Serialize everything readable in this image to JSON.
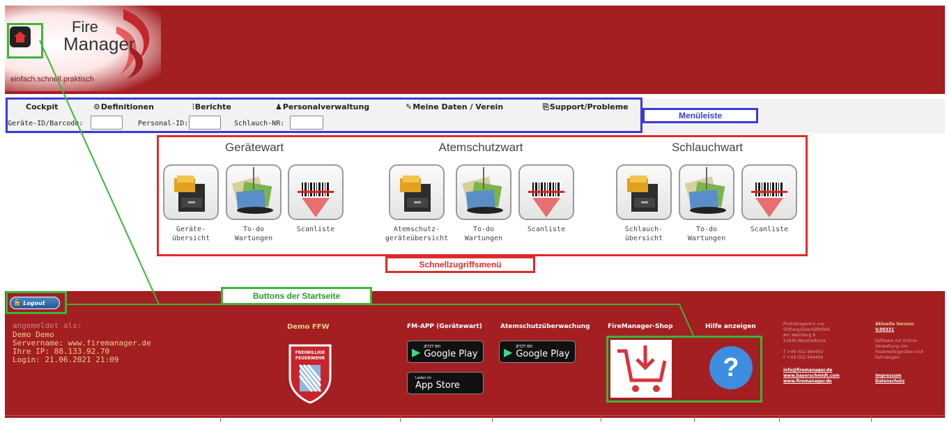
{
  "logo": {
    "line1": "Fire",
    "line2": "Manager",
    "slogan": "einfach.schnell.praktisch"
  },
  "menu": {
    "items": [
      {
        "label": "Cockpit",
        "icon": ""
      },
      {
        "label": "Definitionen",
        "icon": "gear-icon"
      },
      {
        "label": "Berichte",
        "icon": "sliders-icon"
      },
      {
        "label": "Personalverwaltung",
        "icon": "person-icon"
      },
      {
        "label": "Meine Daten / Verein",
        "icon": "wrench-icon"
      },
      {
        "label": "Support/Probleme",
        "icon": "support-icon"
      }
    ],
    "fields": [
      {
        "label": "Geräte-ID/Barcode:",
        "value": ""
      },
      {
        "label": "Personal-ID:",
        "value": ""
      },
      {
        "label": "Schlauch-NR:",
        "value": ""
      }
    ]
  },
  "callouts": {
    "menu": "Menüleiste",
    "quick": "Schnellzugriffsmenü",
    "buttons": "Buttons der Startseite"
  },
  "groups": [
    {
      "title": "Gerätewart",
      "tiles": [
        {
          "line1": "Geräte-",
          "line2": "übersicht",
          "icon": "file-cabinet-icon"
        },
        {
          "line1": "To-do",
          "line2": "Wartungen",
          "icon": "documents-icon"
        },
        {
          "line1": "Scanliste",
          "line2": "",
          "icon": "barcode-icon"
        }
      ]
    },
    {
      "title": "Atemschutzwart",
      "tiles": [
        {
          "line1": "Atemschutz-",
          "line2": "geräteübersicht",
          "icon": "file-cabinet-icon"
        },
        {
          "line1": "To-do",
          "line2": "Wartungen",
          "icon": "documents-icon"
        },
        {
          "line1": "Scanliste",
          "line2": "",
          "icon": "barcode-icon"
        }
      ]
    },
    {
      "title": "Schlauchwart",
      "tiles": [
        {
          "line1": "Schlauch-",
          "line2": "übersicht",
          "icon": "file-cabinet-icon"
        },
        {
          "line1": "To-do",
          "line2": "Wartungen",
          "icon": "documents-icon"
        },
        {
          "line1": "Scanliste",
          "line2": "",
          "icon": "barcode-icon"
        }
      ]
    }
  ],
  "footer": {
    "logout_label": "Logout",
    "login_info": [
      "angemeldet als:",
      "Demo Demo",
      "Servername: www.firemanager.de",
      "Ihre IP: 88.133.92.70",
      "Login: 21.06.2021 21:09"
    ],
    "org_name": "Demo FFW",
    "badge": {
      "line1": "FREIWILLIGE",
      "line2": "FEUERWEHR"
    },
    "app_heading": "FM-APP (Gerätewart)",
    "breath_heading": "Atemschutzüberwachung",
    "shop_heading": "FireManager-Shop",
    "help_heading": "Hilfe anzeigen",
    "store": {
      "gp_small": "JETZT BEI",
      "gp_big": "Google Play",
      "as_small": "Laden im",
      "as_big": "App Store"
    },
    "company": [
      "Produktagentur xxx",
      "Stiftung/Geschäftsfeld",
      "Am Weinberg 8",
      "51645 Neustadt/xxx",
      "",
      "T +49 (0)2 944403",
      "F +49 (0)2 944404"
    ],
    "links": [
      "info@firemanager.de",
      "www.bayerschmidt.com",
      "www.firemanager.de"
    ],
    "version_label": "Aktuelle Version",
    "version": "V.00331",
    "version_desc": [
      "Software zur Online-",
      "Verwaltung von",
      "Feuerwehrgeräten und",
      "Fahrzeugen"
    ],
    "legal": [
      "Impressum",
      "Datenschutz"
    ],
    "help_symbol": "?"
  },
  "colors": {
    "header_red": "#a31f22",
    "highlight_green": "#3bb53b",
    "highlight_blue": "#3a3ad8",
    "highlight_red": "#e02a2a",
    "footer_text": "#e8d28a"
  }
}
